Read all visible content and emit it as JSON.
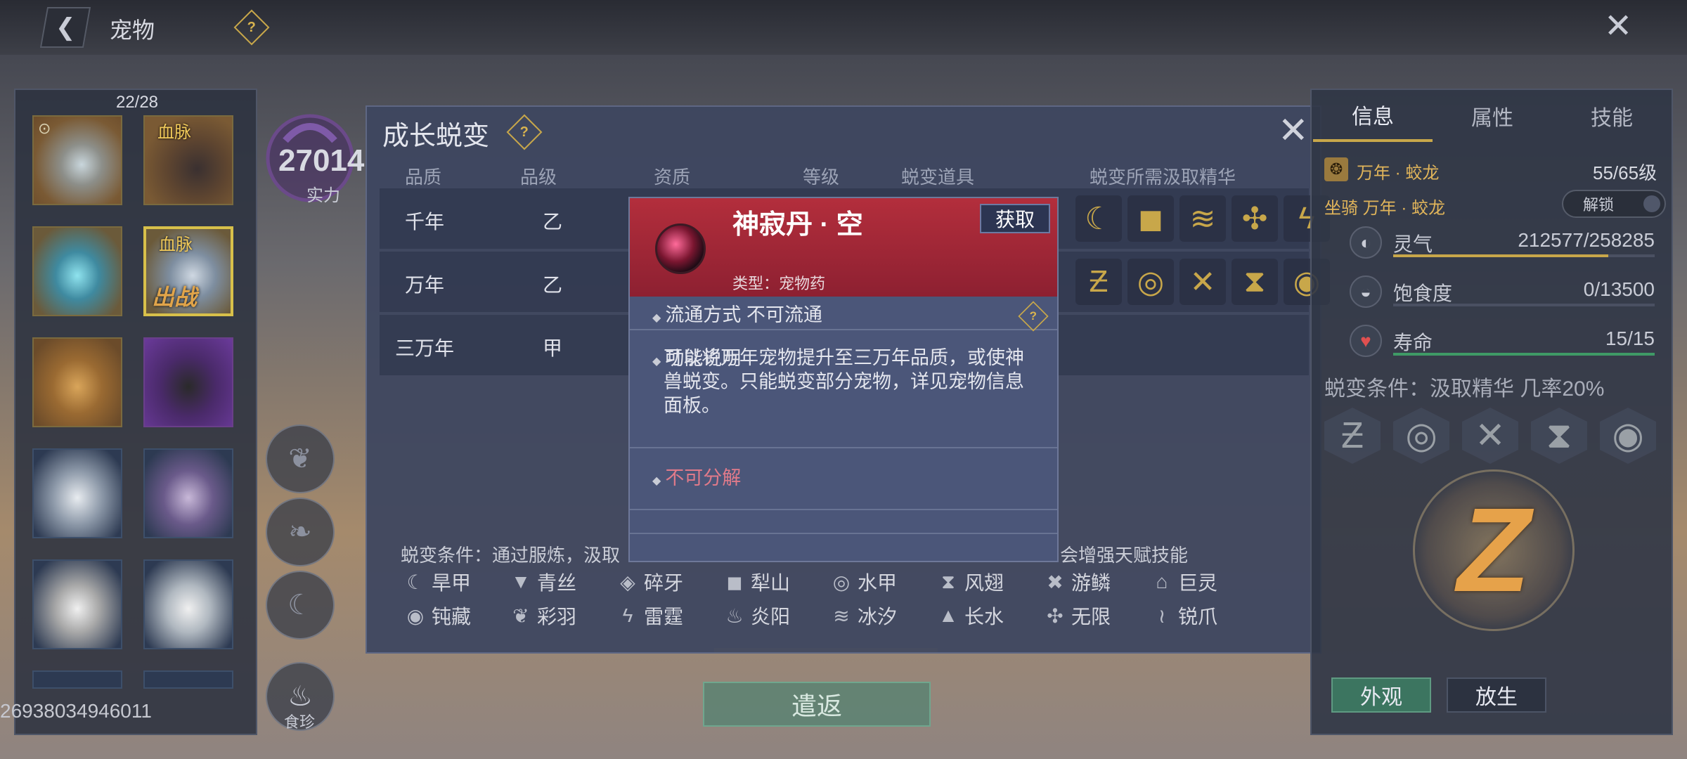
{
  "header": {
    "title": "宠物",
    "help": "?",
    "close": "✕",
    "back": "❮"
  },
  "pet_list": {
    "count": "22/28",
    "bloodline_label": "血脉",
    "active_label": "出战",
    "pet_id": "26938034946011"
  },
  "power": {
    "value": "27014",
    "label": "实力"
  },
  "side_buttons": {
    "food_label": "食珍"
  },
  "growth": {
    "title": "成长蜕变",
    "help": "?",
    "close": "✕",
    "columns": [
      "品质",
      "品级",
      "资质",
      "等级",
      "蜕变道具",
      "蜕变所需汲取精华"
    ],
    "rows": [
      {
        "quality": "千年",
        "grade": "乙"
      },
      {
        "quality": "万年",
        "grade": "乙"
      },
      {
        "quality": "三万年",
        "grade": "甲"
      }
    ],
    "condition_prefix": "蜕变条件：通过服炼，汲取",
    "condition_suffix": "会增强天赋技能",
    "traits": [
      {
        "icon": "☾",
        "name": "旱甲"
      },
      {
        "icon": "▼",
        "name": "青丝"
      },
      {
        "icon": "◈",
        "name": "碎牙"
      },
      {
        "icon": "◼",
        "name": "犁山"
      },
      {
        "icon": "◎",
        "name": "水甲"
      },
      {
        "icon": "⧗",
        "name": "风翅"
      },
      {
        "icon": "✖",
        "name": "游鳞"
      },
      {
        "icon": "⌂",
        "name": "巨灵"
      },
      {
        "icon": "◉",
        "name": "钝藏"
      },
      {
        "icon": "❦",
        "name": "彩羽"
      },
      {
        "icon": "ϟ",
        "name": "雷霆"
      },
      {
        "icon": "♨",
        "name": "炎阳"
      },
      {
        "icon": "≋",
        "name": "冰汐"
      },
      {
        "icon": "▲",
        "name": "长水"
      },
      {
        "icon": "✣",
        "name": "无限"
      },
      {
        "icon": "≀",
        "name": "锐爪"
      }
    ]
  },
  "tooltip": {
    "name": "神寂丹 · 空",
    "get_label": "获取",
    "type": "类型：宠物药",
    "circulation": "流通方式   不可流通",
    "func_title": "功能说明",
    "func_desc": "可以将万年宠物提升至三万年品质，或使神兽蜕变。只能蜕变部分宠物，详见宠物信息面板。",
    "no_decompose": "不可分解",
    "bullet": "◆",
    "help": "?"
  },
  "info": {
    "tabs": [
      "信息",
      "属性",
      "技能"
    ],
    "pet_name": "万年 · 蛟龙",
    "pet_level": "55/65级",
    "mount_label": "坐骑 万年 · 蛟龙",
    "unlock_label": "解锁",
    "stats": [
      {
        "label": "灵气",
        "value": "212577/258285",
        "fill": 0.823,
        "color": "#c8a74a",
        "icon": "◐"
      },
      {
        "label": "饱食度",
        "value": "0/13500",
        "fill": 0,
        "color": "#c8a74a",
        "icon": "◒"
      },
      {
        "label": "寿命",
        "value": "15/15",
        "fill": 1.0,
        "color": "#3f9a66",
        "icon": "♥"
      }
    ],
    "evo_condition": "蜕变条件：汲取精华 几率20%",
    "evo_icons": [
      "Ƶ",
      "◎",
      "✕",
      "⧗",
      "◉"
    ],
    "emblem_glyph": "Z",
    "appearance_label": "外观",
    "release_label": "放生"
  },
  "bottom": {
    "dismiss_label": "遣返"
  }
}
